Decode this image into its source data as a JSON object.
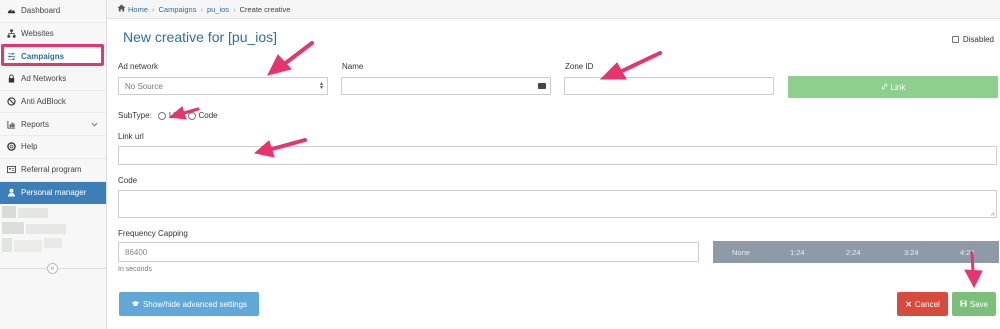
{
  "sidebar": {
    "items": [
      {
        "label": "Dashboard",
        "icon": "dashboard-icon"
      },
      {
        "label": "Websites",
        "icon": "sitemap-icon"
      },
      {
        "label": "Campaigns",
        "icon": "sliders-icon"
      },
      {
        "label": "Ad Networks",
        "icon": "lock-icon"
      },
      {
        "label": "Anti AdBlock",
        "icon": "ban-icon"
      },
      {
        "label": "Reports",
        "icon": "chart-icon"
      },
      {
        "label": "Help",
        "icon": "lifebuoy-icon"
      },
      {
        "label": "Referral program",
        "icon": "id-card-icon"
      },
      {
        "label": "Personal manager",
        "icon": "user-icon"
      }
    ],
    "collapse_glyph": "«"
  },
  "breadcrumb": {
    "home": "Home",
    "campaigns": "Campaigns",
    "campaign": "pu_ios",
    "current": "Create creative"
  },
  "form": {
    "title": "New creative for [pu_ios]",
    "disabled_label": "Disabled",
    "ad_network_label": "Ad network",
    "ad_network_value": "No Source",
    "name_label": "Name",
    "name_value": "",
    "zone_id_label": "Zone ID",
    "zone_id_value": "",
    "link_button": "Link",
    "subtype_label": "SubType:",
    "subtype_options": [
      "Link",
      "Code"
    ],
    "link_url_label": "Link url",
    "link_url_value": "",
    "code_label": "Code",
    "code_value": "",
    "frequency_label": "Frequency Capping",
    "frequency_value": "86400",
    "frequency_help": "In seconds",
    "frequency_ticks": [
      "None",
      "1:24",
      "2:24",
      "3:24",
      "4:24"
    ],
    "advanced_button": "Show/hide advanced settings",
    "cancel_button": "Cancel",
    "save_button": "Save"
  },
  "colors": {
    "accent": "#2a6ea6",
    "highlight": "#e8336d",
    "link_button": "#8dcf8d",
    "cancel": "#d74a3d",
    "save": "#7abf7a",
    "advanced": "#5fa8d8",
    "personal_manager": "#3c7fb8"
  }
}
